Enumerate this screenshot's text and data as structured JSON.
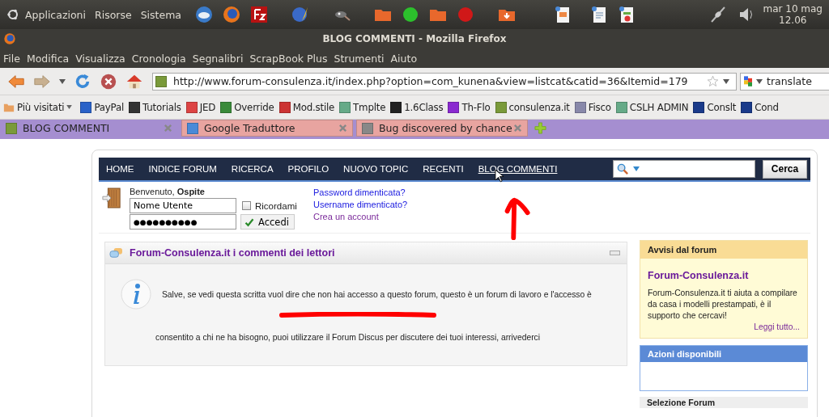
{
  "panel": {
    "menus": [
      "Applicazioni",
      "Risorse",
      "Sistema"
    ],
    "clock_date": "mar 10 mag",
    "clock_time": "12.06"
  },
  "window": {
    "title": "BLOG COMMENTI - Mozilla Firefox"
  },
  "menu_bar": [
    "File",
    "Modifica",
    "Visualizza",
    "Cronologia",
    "Segnalibri",
    "ScrapBook Plus",
    "Strumenti",
    "Aiuto"
  ],
  "nav_toolbar": {
    "url": "http://www.forum-consulenza.it/index.php?option=com_kunena&view=listcat&catid=36&Itemid=179",
    "search": "translate"
  },
  "bookmarks": [
    {
      "label": "Più visitati",
      "kind": "folder"
    },
    {
      "label": "PayPal",
      "kind": "link"
    },
    {
      "label": "Tutorials",
      "kind": "link"
    },
    {
      "label": "JED",
      "kind": "link"
    },
    {
      "label": "Override",
      "kind": "link"
    },
    {
      "label": "Mod.stile",
      "kind": "link"
    },
    {
      "label": "Tmplte",
      "kind": "link"
    },
    {
      "label": "1.6Class",
      "kind": "link"
    },
    {
      "label": "Th-Flo",
      "kind": "link"
    },
    {
      "label": "consulenza.it",
      "kind": "link"
    },
    {
      "label": "Fisco",
      "kind": "link"
    },
    {
      "label": "CSLH ADMIN",
      "kind": "link"
    },
    {
      "label": "Conslt",
      "kind": "link"
    },
    {
      "label": "Cond",
      "kind": "link"
    }
  ],
  "tabs": [
    {
      "label": "BLOG COMMENTI",
      "selected": true
    },
    {
      "label": "Google Traduttore",
      "selected": false
    },
    {
      "label": "Bug discovered by chance",
      "selected": false
    }
  ],
  "site_nav": {
    "items": [
      {
        "label": "HOME",
        "active": false
      },
      {
        "label": "INDICE FORUM",
        "active": false
      },
      {
        "label": "RICERCA",
        "active": false
      },
      {
        "label": "PROFILO",
        "active": false
      },
      {
        "label": "NUOVO TOPIC",
        "active": false
      },
      {
        "label": "RECENTI",
        "active": false
      },
      {
        "label": "BLOG COMMENTI",
        "active": true
      }
    ],
    "search_button": "Cerca"
  },
  "login": {
    "welcome": "Benvenuto, **Ospite**",
    "username": "Nome Utente",
    "password": "●●●●●●●●●●",
    "remember_label": "Ricordami",
    "remember_checked": false,
    "submit": "Accedi",
    "links": [
      {
        "label": "Password dimenticata?",
        "visited": false
      },
      {
        "label": "Username dimenticato?",
        "visited": false
      },
      {
        "label": "Crea un account",
        "visited": true
      }
    ]
  },
  "category": {
    "title": "Forum-Consulenza.it i commenti dei lettori",
    "message_lines": [
      "Salve, se vedi questa scritta vuol dire che non hai accesso a questo forum, questo è un forum di lavoro e l'accesso è",
      "consentito a chi ne ha bisogno, puoi utilizzare il Forum Discus per discutere dei tuoi interessi, arrivederci"
    ]
  },
  "sidebar": {
    "notice": {
      "header": "Avvisi dal forum",
      "title": "Forum-Consulenza.it",
      "text": "Forum-Consulenza.it ti aiuta a compilare da casa i modelli prestampati, è il supporto che cercavi!",
      "link": "Leggi tutto..."
    },
    "actions": {
      "header": "Azioni disponibili"
    },
    "forum_select": {
      "header": "Selezione Forum"
    }
  }
}
